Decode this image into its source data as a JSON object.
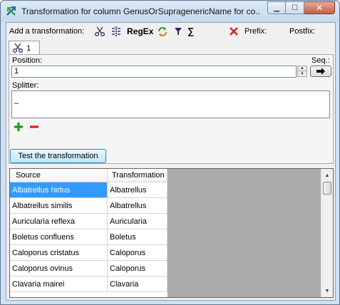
{
  "window": {
    "title": "Transformation for column GenusOrSupragenericName for co...",
    "minimize_glyph": "▁",
    "maximize_glyph": "☐",
    "close_glyph": "✕"
  },
  "toolbar": {
    "add_label": "Add a transformation:",
    "regex_label": "RegEx",
    "sum_glyph": "∑",
    "prefix_label": "Prefix:",
    "postfix_label": "Postfix:"
  },
  "tab": {
    "label": "1"
  },
  "position": {
    "label": "Position:",
    "value": "1"
  },
  "sequence": {
    "label": "Seq.:"
  },
  "splitter": {
    "label": "Splitter:",
    "value": "–"
  },
  "test_button": {
    "label": "Test the transformation"
  },
  "grid": {
    "columns": [
      "Source",
      "Transformation"
    ],
    "rows": [
      {
        "source": "Albatrellus hirtus",
        "transformation": "Albatrellus"
      },
      {
        "source": "Albatrellus similis",
        "transformation": "Albatrellus"
      },
      {
        "source": "Auricularia reflexa",
        "transformation": "Auricularia"
      },
      {
        "source": "Boletus confluens",
        "transformation": "Boletus"
      },
      {
        "source": "Caloporus cristatus",
        "transformation": "Caloporus"
      },
      {
        "source": "Caloporus ovinus",
        "transformation": "Caloporus"
      },
      {
        "source": "Clavaria mairei",
        "transformation": "Clavaria"
      }
    ],
    "selected_row": 0
  },
  "colors": {
    "selection": "#3399ff",
    "add_green": "#1e9e1e",
    "remove_red": "#d42020"
  }
}
